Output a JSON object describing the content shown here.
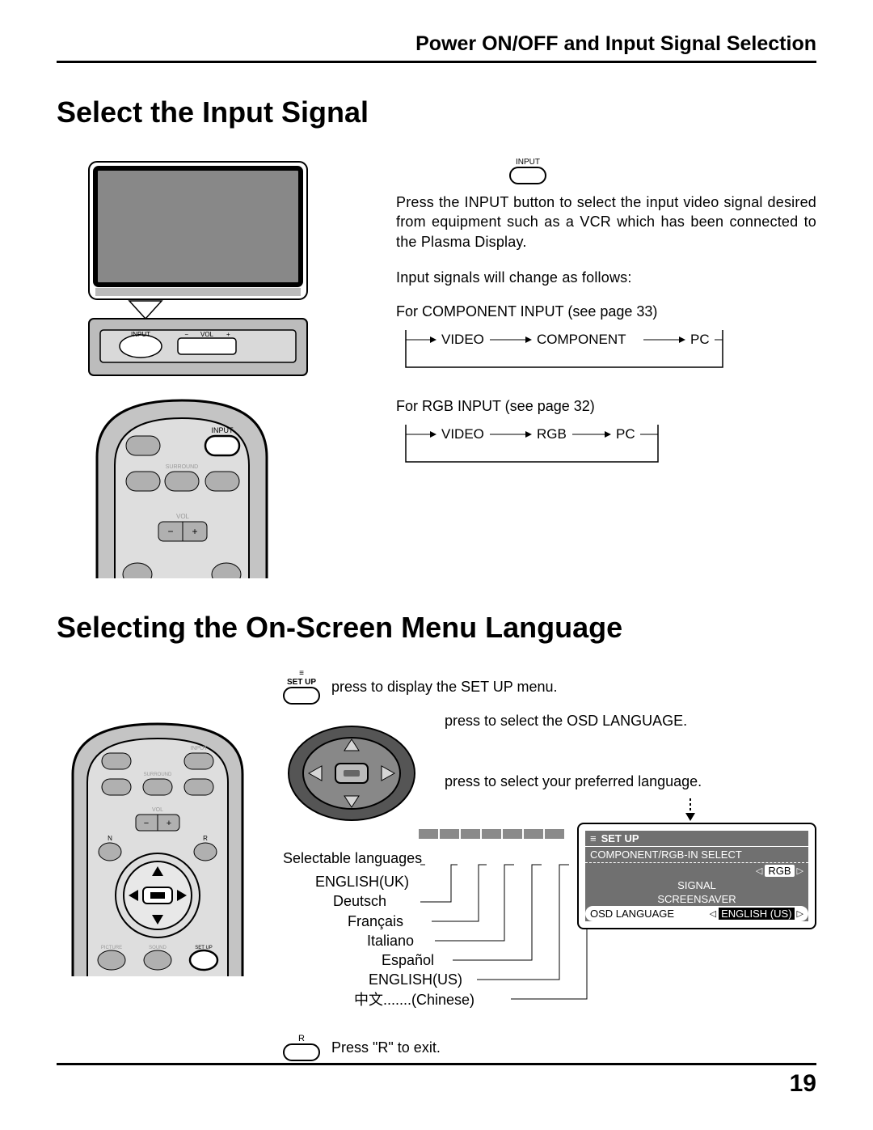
{
  "header_title": "Power ON/OFF and Input Signal Selection",
  "section1": {
    "title": "Select the Input Signal",
    "input_btn_label": "INPUT",
    "para1": "Press the INPUT button to select the input video signal desired from equipment such as a VCR which has been connected to the Plasma Display.",
    "para2": "Input signals will change as follows:",
    "flow1_label": "For COMPONENT INPUT (see page 33)",
    "flow1_items": [
      "VIDEO",
      "COMPONENT",
      "PC"
    ],
    "flow2_label": "For RGB INPUT (see page 32)",
    "flow2_items": [
      "VIDEO",
      "RGB",
      "PC"
    ],
    "panel_buttons": {
      "input": "INPUT",
      "vol": "VOL",
      "plus": "+",
      "minus": "−"
    },
    "remote_labels": {
      "input": "INPUT",
      "surround": "SURROUND",
      "vol": "VOL",
      "plus": "+",
      "minus": "−"
    }
  },
  "section2": {
    "title": "Selecting the On-Screen Menu Language",
    "setup_btn_top1": "≡",
    "setup_btn_top2": "SET UP",
    "instr1": "press to display the SET UP menu.",
    "instr2": "press to select the OSD LANGUAGE.",
    "instr3": "press to select your preferred language.",
    "lang_head": "Selectable languages",
    "languages": [
      "ENGLISH(UK)",
      "Deutsch",
      "Français",
      "Italiano",
      "Español",
      "ENGLISH(US)",
      "中文.......(Chinese)"
    ],
    "exit_label": "R",
    "exit_text": "Press \"R\" to exit.",
    "remote_labels": {
      "input": "INPUT",
      "surround": "SURROUND",
      "vol": "VOL",
      "n": "N",
      "r": "R",
      "picture": "PICTURE",
      "sound": "SOUND",
      "setup": "SET UP",
      "plus": "+",
      "minus": "−"
    }
  },
  "osd": {
    "title": "SET UP",
    "row1_label": "COMPONENT/RGB-IN SELECT",
    "row1_val": "RGB",
    "row2": "SIGNAL",
    "row3": "SCREENSAVER",
    "row4_label": "OSD  LANGUAGE",
    "row4_val": "ENGLISH (US)"
  },
  "page_number": "19"
}
